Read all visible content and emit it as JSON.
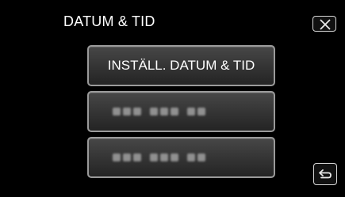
{
  "header": {
    "title": "DATUM & TID"
  },
  "menu": {
    "primary_label": "INSTÄLL. DATUM & TID",
    "item2_blurred": true,
    "item3_blurred": true
  },
  "icons": {
    "close": "close-icon",
    "back": "return-arrow-icon"
  },
  "colors": {
    "background": "#000000",
    "button_border": "#9a9a9a",
    "text": "#ffffff"
  }
}
